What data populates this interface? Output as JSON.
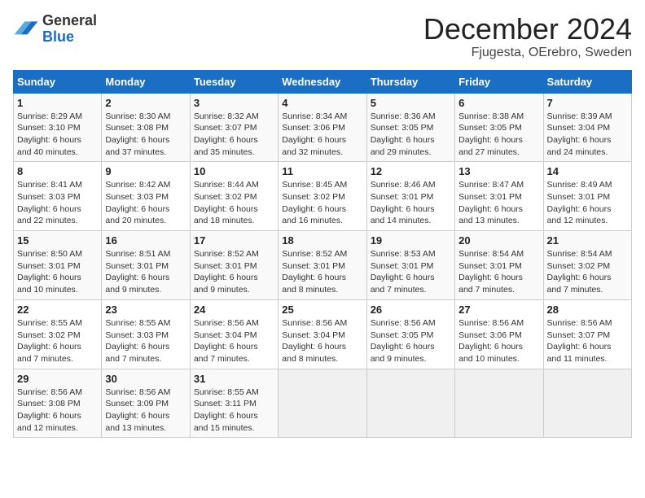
{
  "logo": {
    "general": "General",
    "blue": "Blue"
  },
  "title": "December 2024",
  "subtitle": "Fjugesta, OErebro, Sweden",
  "days_of_week": [
    "Sunday",
    "Monday",
    "Tuesday",
    "Wednesday",
    "Thursday",
    "Friday",
    "Saturday"
  ],
  "weeks": [
    [
      {
        "day": "1",
        "info": "Sunrise: 8:29 AM\nSunset: 3:10 PM\nDaylight: 6 hours\nand 40 minutes."
      },
      {
        "day": "2",
        "info": "Sunrise: 8:30 AM\nSunset: 3:08 PM\nDaylight: 6 hours\nand 37 minutes."
      },
      {
        "day": "3",
        "info": "Sunrise: 8:32 AM\nSunset: 3:07 PM\nDaylight: 6 hours\nand 35 minutes."
      },
      {
        "day": "4",
        "info": "Sunrise: 8:34 AM\nSunset: 3:06 PM\nDaylight: 6 hours\nand 32 minutes."
      },
      {
        "day": "5",
        "info": "Sunrise: 8:36 AM\nSunset: 3:05 PM\nDaylight: 6 hours\nand 29 minutes."
      },
      {
        "day": "6",
        "info": "Sunrise: 8:38 AM\nSunset: 3:05 PM\nDaylight: 6 hours\nand 27 minutes."
      },
      {
        "day": "7",
        "info": "Sunrise: 8:39 AM\nSunset: 3:04 PM\nDaylight: 6 hours\nand 24 minutes."
      }
    ],
    [
      {
        "day": "8",
        "info": "Sunrise: 8:41 AM\nSunset: 3:03 PM\nDaylight: 6 hours\nand 22 minutes."
      },
      {
        "day": "9",
        "info": "Sunrise: 8:42 AM\nSunset: 3:03 PM\nDaylight: 6 hours\nand 20 minutes."
      },
      {
        "day": "10",
        "info": "Sunrise: 8:44 AM\nSunset: 3:02 PM\nDaylight: 6 hours\nand 18 minutes."
      },
      {
        "day": "11",
        "info": "Sunrise: 8:45 AM\nSunset: 3:02 PM\nDaylight: 6 hours\nand 16 minutes."
      },
      {
        "day": "12",
        "info": "Sunrise: 8:46 AM\nSunset: 3:01 PM\nDaylight: 6 hours\nand 14 minutes."
      },
      {
        "day": "13",
        "info": "Sunrise: 8:47 AM\nSunset: 3:01 PM\nDaylight: 6 hours\nand 13 minutes."
      },
      {
        "day": "14",
        "info": "Sunrise: 8:49 AM\nSunset: 3:01 PM\nDaylight: 6 hours\nand 12 minutes."
      }
    ],
    [
      {
        "day": "15",
        "info": "Sunrise: 8:50 AM\nSunset: 3:01 PM\nDaylight: 6 hours\nand 10 minutes."
      },
      {
        "day": "16",
        "info": "Sunrise: 8:51 AM\nSunset: 3:01 PM\nDaylight: 6 hours\nand 9 minutes."
      },
      {
        "day": "17",
        "info": "Sunrise: 8:52 AM\nSunset: 3:01 PM\nDaylight: 6 hours\nand 9 minutes."
      },
      {
        "day": "18",
        "info": "Sunrise: 8:52 AM\nSunset: 3:01 PM\nDaylight: 6 hours\nand 8 minutes."
      },
      {
        "day": "19",
        "info": "Sunrise: 8:53 AM\nSunset: 3:01 PM\nDaylight: 6 hours\nand 7 minutes."
      },
      {
        "day": "20",
        "info": "Sunrise: 8:54 AM\nSunset: 3:01 PM\nDaylight: 6 hours\nand 7 minutes."
      },
      {
        "day": "21",
        "info": "Sunrise: 8:54 AM\nSunset: 3:02 PM\nDaylight: 6 hours\nand 7 minutes."
      }
    ],
    [
      {
        "day": "22",
        "info": "Sunrise: 8:55 AM\nSunset: 3:02 PM\nDaylight: 6 hours\nand 7 minutes."
      },
      {
        "day": "23",
        "info": "Sunrise: 8:55 AM\nSunset: 3:03 PM\nDaylight: 6 hours\nand 7 minutes."
      },
      {
        "day": "24",
        "info": "Sunrise: 8:56 AM\nSunset: 3:04 PM\nDaylight: 6 hours\nand 7 minutes."
      },
      {
        "day": "25",
        "info": "Sunrise: 8:56 AM\nSunset: 3:04 PM\nDaylight: 6 hours\nand 8 minutes."
      },
      {
        "day": "26",
        "info": "Sunrise: 8:56 AM\nSunset: 3:05 PM\nDaylight: 6 hours\nand 9 minutes."
      },
      {
        "day": "27",
        "info": "Sunrise: 8:56 AM\nSunset: 3:06 PM\nDaylight: 6 hours\nand 10 minutes."
      },
      {
        "day": "28",
        "info": "Sunrise: 8:56 AM\nSunset: 3:07 PM\nDaylight: 6 hours\nand 11 minutes."
      }
    ],
    [
      {
        "day": "29",
        "info": "Sunrise: 8:56 AM\nSunset: 3:08 PM\nDaylight: 6 hours\nand 12 minutes."
      },
      {
        "day": "30",
        "info": "Sunrise: 8:56 AM\nSunset: 3:09 PM\nDaylight: 6 hours\nand 13 minutes."
      },
      {
        "day": "31",
        "info": "Sunrise: 8:55 AM\nSunset: 3:11 PM\nDaylight: 6 hours\nand 15 minutes."
      },
      {
        "day": "",
        "info": ""
      },
      {
        "day": "",
        "info": ""
      },
      {
        "day": "",
        "info": ""
      },
      {
        "day": "",
        "info": ""
      }
    ]
  ]
}
